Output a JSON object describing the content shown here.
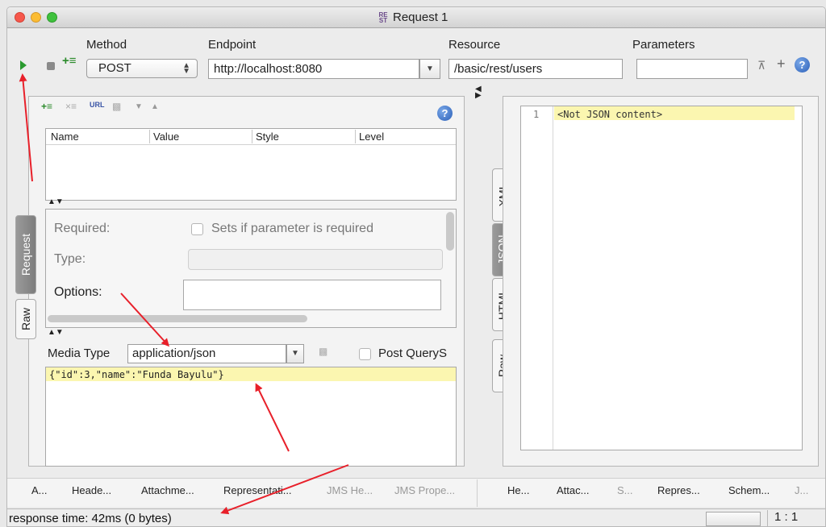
{
  "window": {
    "title": "Request 1",
    "title_icon_lines": [
      "RE",
      "ST"
    ]
  },
  "toolbar": {
    "method_label": "Method",
    "method_value": "POST",
    "endpoint_label": "Endpoint",
    "endpoint_value": "http://localhost:8080",
    "resource_label": "Resource",
    "resource_value": "/basic/rest/users",
    "parameters_label": "Parameters",
    "parameters_value": ""
  },
  "params_table": {
    "columns": [
      "Name",
      "Value",
      "Style",
      "Level"
    ]
  },
  "param_form": {
    "required_label": "Required:",
    "required_checkbox_label": "Sets if parameter is required",
    "type_label": "Type:",
    "options_label": "Options:"
  },
  "media": {
    "label": "Media Type",
    "value": "application/json",
    "post_query_label": "Post QueryS"
  },
  "request_body": "{\"id\":3,\"name\":\"Funda  Bayulu\"}",
  "left_vtabs": [
    "Request",
    "Raw"
  ],
  "response_vtabs": [
    "XML",
    "JSON",
    "HTML",
    "Raw"
  ],
  "response": {
    "line_number": "1",
    "content": "<Not JSON content>"
  },
  "left_bottom_tabs": [
    "A...",
    "Heade...",
    "Attachme...",
    "Representati...",
    "JMS He...",
    "JMS Prope..."
  ],
  "right_bottom_tabs": [
    "He...",
    "Attac...",
    "S...",
    "Repres...",
    "Schem...",
    "J..."
  ],
  "status": {
    "response_time": "response time: 42ms (0 bytes)",
    "position": "1 : 1"
  },
  "colors": {
    "annotation_arrow": "#e8202a",
    "highlight": "#fbf6b0",
    "run_green": "#2a9a2f"
  },
  "icons": [
    "run-icon",
    "stop-icon",
    "add-param-icon",
    "help-icon",
    "expand-icon",
    "collapse-icon"
  ]
}
